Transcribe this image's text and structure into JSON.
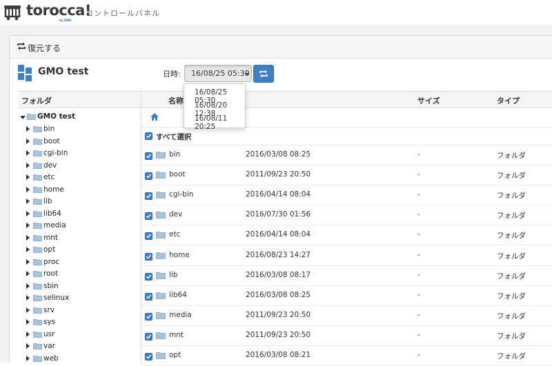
{
  "header": {
    "logo_text": "torocca!",
    "logo_sub": "by GMO",
    "title": "コントロールパネル"
  },
  "panel": {
    "title": "復元する",
    "server_name": "GMO test",
    "datetime_label": "日時:",
    "datetime_selected": "16/08/25 05:30",
    "datetime_options": [
      "16/08/25 05:30",
      "16/08/20 12:38",
      "16/08/11 20:25"
    ]
  },
  "tree": {
    "header": "フォルダ",
    "root": "GMO test",
    "items": [
      "bin",
      "boot",
      "cgi-bin",
      "dev",
      "etc",
      "home",
      "lib",
      "lib64",
      "media",
      "mnt",
      "opt",
      "proc",
      "root",
      "sbin",
      "selinux",
      "srv",
      "sys",
      "usr",
      "var",
      "web"
    ]
  },
  "list": {
    "col_name": "名称",
    "col_size": "サイズ",
    "col_type": "タイプ",
    "select_all": "すべて選択",
    "rows": [
      {
        "name": "bin",
        "date": "2016/03/08 08:25",
        "size": "-",
        "type": "フォルダ"
      },
      {
        "name": "boot",
        "date": "2011/09/23 20:50",
        "size": "-",
        "type": "フォルダ"
      },
      {
        "name": "cgi-bin",
        "date": "2016/04/14 08:04",
        "size": "-",
        "type": "フォルダ"
      },
      {
        "name": "dev",
        "date": "2016/07/30 01:56",
        "size": "-",
        "type": "フォルダ"
      },
      {
        "name": "etc",
        "date": "2016/04/14 08:04",
        "size": "-",
        "type": "フォルダ"
      },
      {
        "name": "home",
        "date": "2016/08/23 14:27",
        "size": "-",
        "type": "フォルダ"
      },
      {
        "name": "lib",
        "date": "2016/03/08 08:17",
        "size": "-",
        "type": "フォルダ"
      },
      {
        "name": "lib64",
        "date": "2016/03/08 08:25",
        "size": "-",
        "type": "フォルダ"
      },
      {
        "name": "media",
        "date": "2011/09/23 20:50",
        "size": "-",
        "type": "フォルダ"
      },
      {
        "name": "mnt",
        "date": "2011/09/23 20:50",
        "size": "-",
        "type": "フォルダ"
      },
      {
        "name": "opt",
        "date": "2016/03/08 08:21",
        "size": "-",
        "type": "フォルダ"
      }
    ]
  },
  "colors": {
    "accent": "#3f80c3",
    "folder": "#a9c4dd"
  }
}
